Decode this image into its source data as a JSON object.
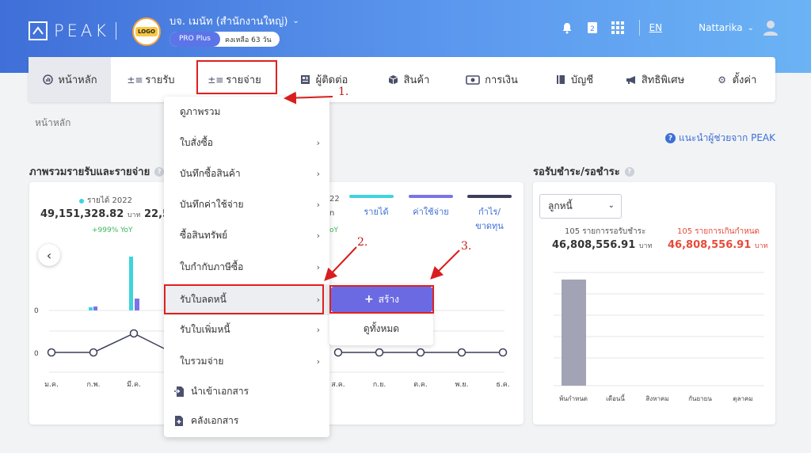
{
  "brand": {
    "name": "PEAK"
  },
  "company": {
    "logo_text": "LOGO",
    "name": "บจ. เมนัท (สำนักงานใหญ่)",
    "plan": "PRO Plus",
    "remaining": "คงเหลือ 63 วัน"
  },
  "top_right": {
    "lang": "EN",
    "user": "Nattarika"
  },
  "nav": [
    {
      "label": "หน้าหลัก",
      "icon": "dashboard-icon"
    },
    {
      "label": "รายรับ",
      "icon": "income-icon"
    },
    {
      "label": "รายจ่าย",
      "icon": "expense-icon"
    },
    {
      "label": "ผู้ติดต่อ",
      "icon": "contact-icon"
    },
    {
      "label": "สินค้า",
      "icon": "box-icon"
    },
    {
      "label": "การเงิน",
      "icon": "money-icon"
    },
    {
      "label": "บัญชี",
      "icon": "book-icon"
    },
    {
      "label": "สิทธิพิเศษ",
      "icon": "megaphone-icon"
    },
    {
      "label": "ตั้งค่า",
      "icon": "gear-icon"
    }
  ],
  "breadcrumb": "หน้าหลัก",
  "help_link": "แนะนำผู้ช่วยจาก PEAK",
  "income_expense": {
    "title": "ภาพรวมรายรับและรายจ่าย",
    "income_label": "รายได้ 2022",
    "income_value": "49,151,328.82",
    "currency": "บาท",
    "income_yoy": "+999% YoY",
    "second_value_partial": "22,5",
    "partial_label_1": "22",
    "partial_label_2": "n",
    "partial_label_3": "oY",
    "legend": [
      "รายได้",
      "ค่าใช้จ่าย",
      "กำไร/ขาดทุน"
    ],
    "months_visible": [
      "ม.ค.",
      "ก.พ.",
      "มี.ค.",
      "ส.ค.",
      "ก.ย.",
      "ต.ค.",
      "พ.ย.",
      "ธ.ค."
    ],
    "zero_label": "0"
  },
  "dropdown": {
    "items": [
      {
        "label": "ดูภาพรวม",
        "arrow": false
      },
      {
        "label": "ใบสั่งซื้อ",
        "arrow": true
      },
      {
        "label": "บันทึกซื้อสินค้า",
        "arrow": true
      },
      {
        "label": "บันทึกค่าใช้จ่าย",
        "arrow": true
      },
      {
        "label": "ซื้อสินทรัพย์",
        "arrow": true
      },
      {
        "label": "ใบกำกับภาษีซื้อ",
        "arrow": true
      },
      {
        "label": "รับใบลดหนี้",
        "arrow": true
      },
      {
        "label": "รับใบเพิ่มหนี้",
        "arrow": true
      },
      {
        "label": "ใบรวมจ่าย",
        "arrow": true
      },
      {
        "label": "นำเข้าเอกสาร",
        "arrow": false
      },
      {
        "label": "คลังเอกสาร",
        "arrow": false
      }
    ],
    "submenu": {
      "create": "สร้าง",
      "view_all": "ดูทั้งหมด"
    }
  },
  "annotations": [
    "1.",
    "2.",
    "3."
  ],
  "receivable": {
    "title": "รอรับชำระ/รอชำระ",
    "select": "ลูกหนี้",
    "left_label": "105 รายการรอรับชำระ",
    "left_value": "46,808,556.91",
    "right_label": "105 รายการเกินกำหนด",
    "right_value": "46,808,556.91",
    "currency": "บาท",
    "categories": [
      "พ้นกำหนด",
      "เดือนนี้",
      "สิงหาคม",
      "กันยายน",
      "ตุลาคม"
    ]
  },
  "colors": {
    "income": "#3ed4dd",
    "expense": "#7a74e8",
    "profit": "#3c3f5a",
    "accent": "#6b6ae3",
    "overdue": "#e84a3a"
  }
}
